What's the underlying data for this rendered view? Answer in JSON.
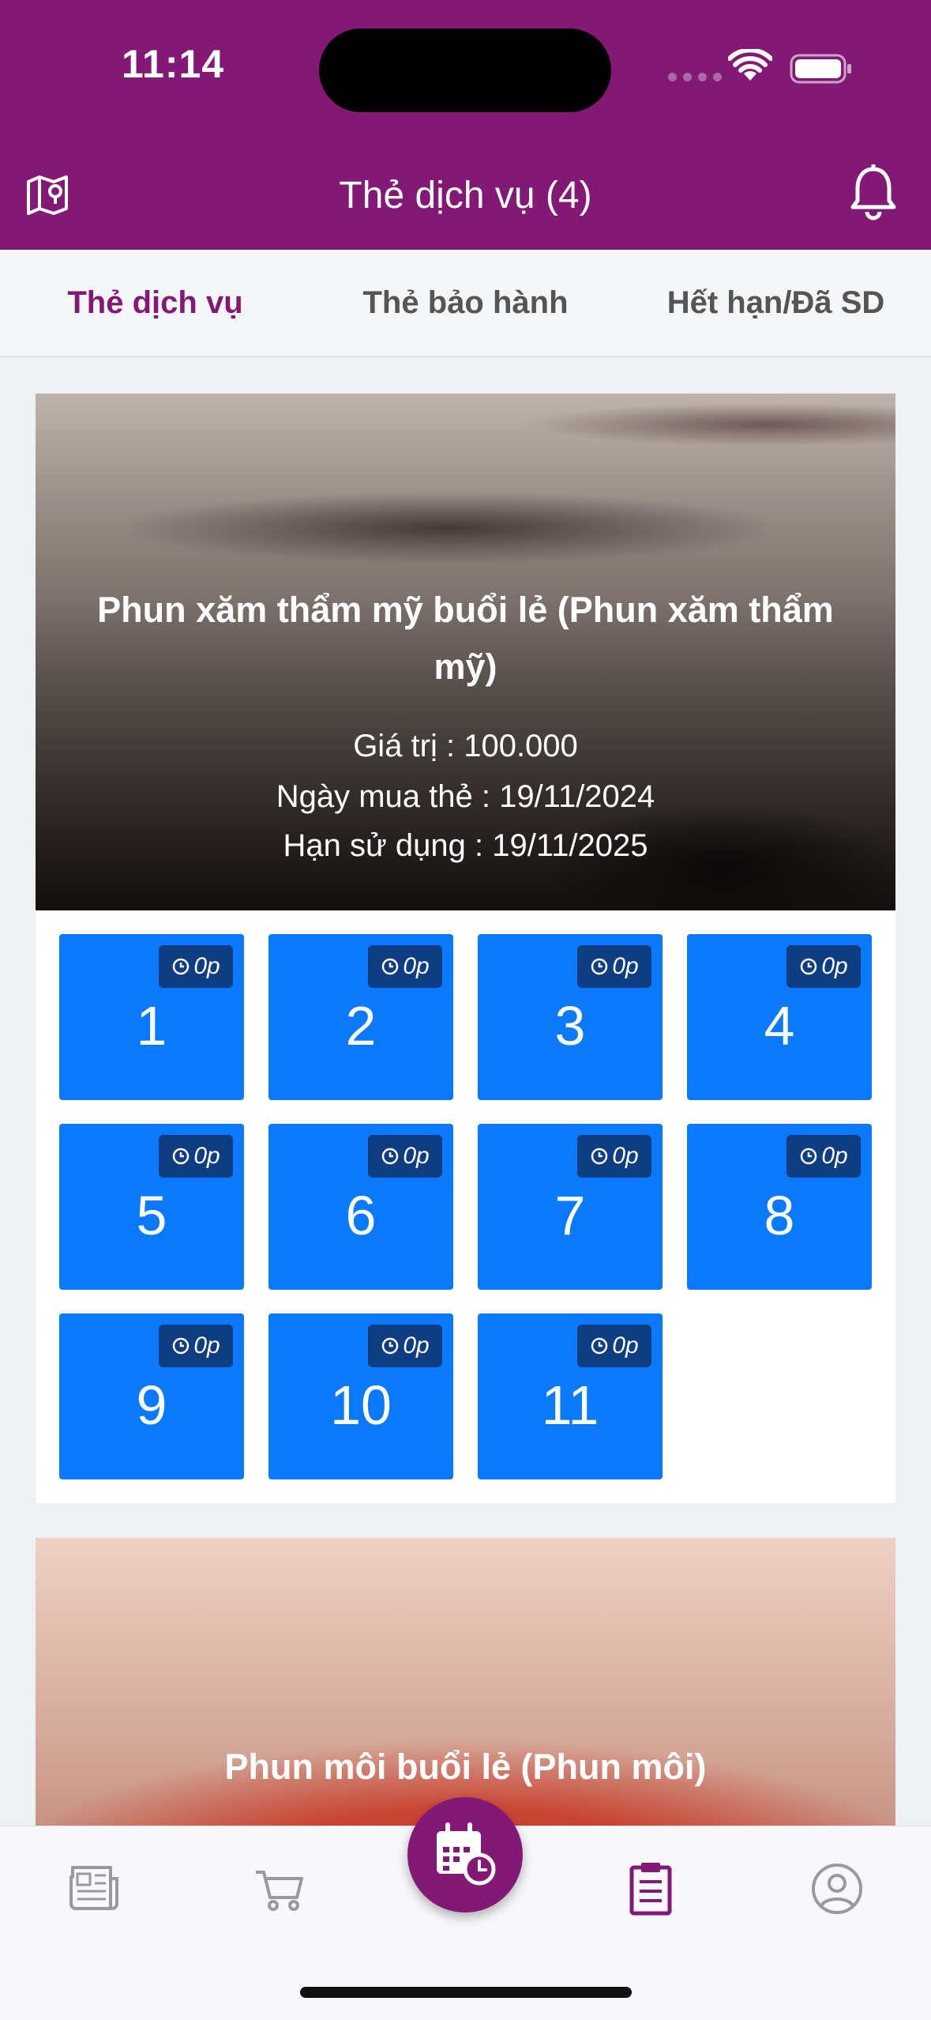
{
  "status_bar": {
    "time": "11:14"
  },
  "header": {
    "title": "Thẻ dịch vụ (4)"
  },
  "tabs": [
    {
      "label": "Thẻ dịch vụ",
      "active": true
    },
    {
      "label": "Thẻ bảo hành",
      "active": false
    },
    {
      "label": "Hết hạn/Đã SD",
      "active": false
    }
  ],
  "cards": [
    {
      "title": "Phun xăm thẩm mỹ buổi lẻ (Phun xăm thẩm mỹ)",
      "value": "Giá trị : 100.000",
      "purchase_date": "Ngày mua thẻ : 19/11/2024",
      "expiry": "Hạn sử dụng : 19/11/2025",
      "sessions": [
        {
          "number": "1",
          "duration": "0p"
        },
        {
          "number": "2",
          "duration": "0p"
        },
        {
          "number": "3",
          "duration": "0p"
        },
        {
          "number": "4",
          "duration": "0p"
        },
        {
          "number": "5",
          "duration": "0p"
        },
        {
          "number": "6",
          "duration": "0p"
        },
        {
          "number": "7",
          "duration": "0p"
        },
        {
          "number": "8",
          "duration": "0p"
        },
        {
          "number": "9",
          "duration": "0p"
        },
        {
          "number": "10",
          "duration": "0p"
        },
        {
          "number": "11",
          "duration": "0p"
        }
      ]
    },
    {
      "title": "Phun môi buổi lẻ (Phun môi)"
    }
  ],
  "bottom_nav": {
    "items": [
      {
        "icon": "newspaper-icon",
        "active": false
      },
      {
        "icon": "cart-icon",
        "active": false
      },
      {
        "icon": "calendar-clock-icon",
        "active": false
      },
      {
        "icon": "clipboard-icon",
        "active": true
      },
      {
        "icon": "user-circle-icon",
        "active": false
      }
    ]
  },
  "colors": {
    "brand": "#821a75",
    "tile": "#0a79fc",
    "badge": "#0e3d82"
  }
}
